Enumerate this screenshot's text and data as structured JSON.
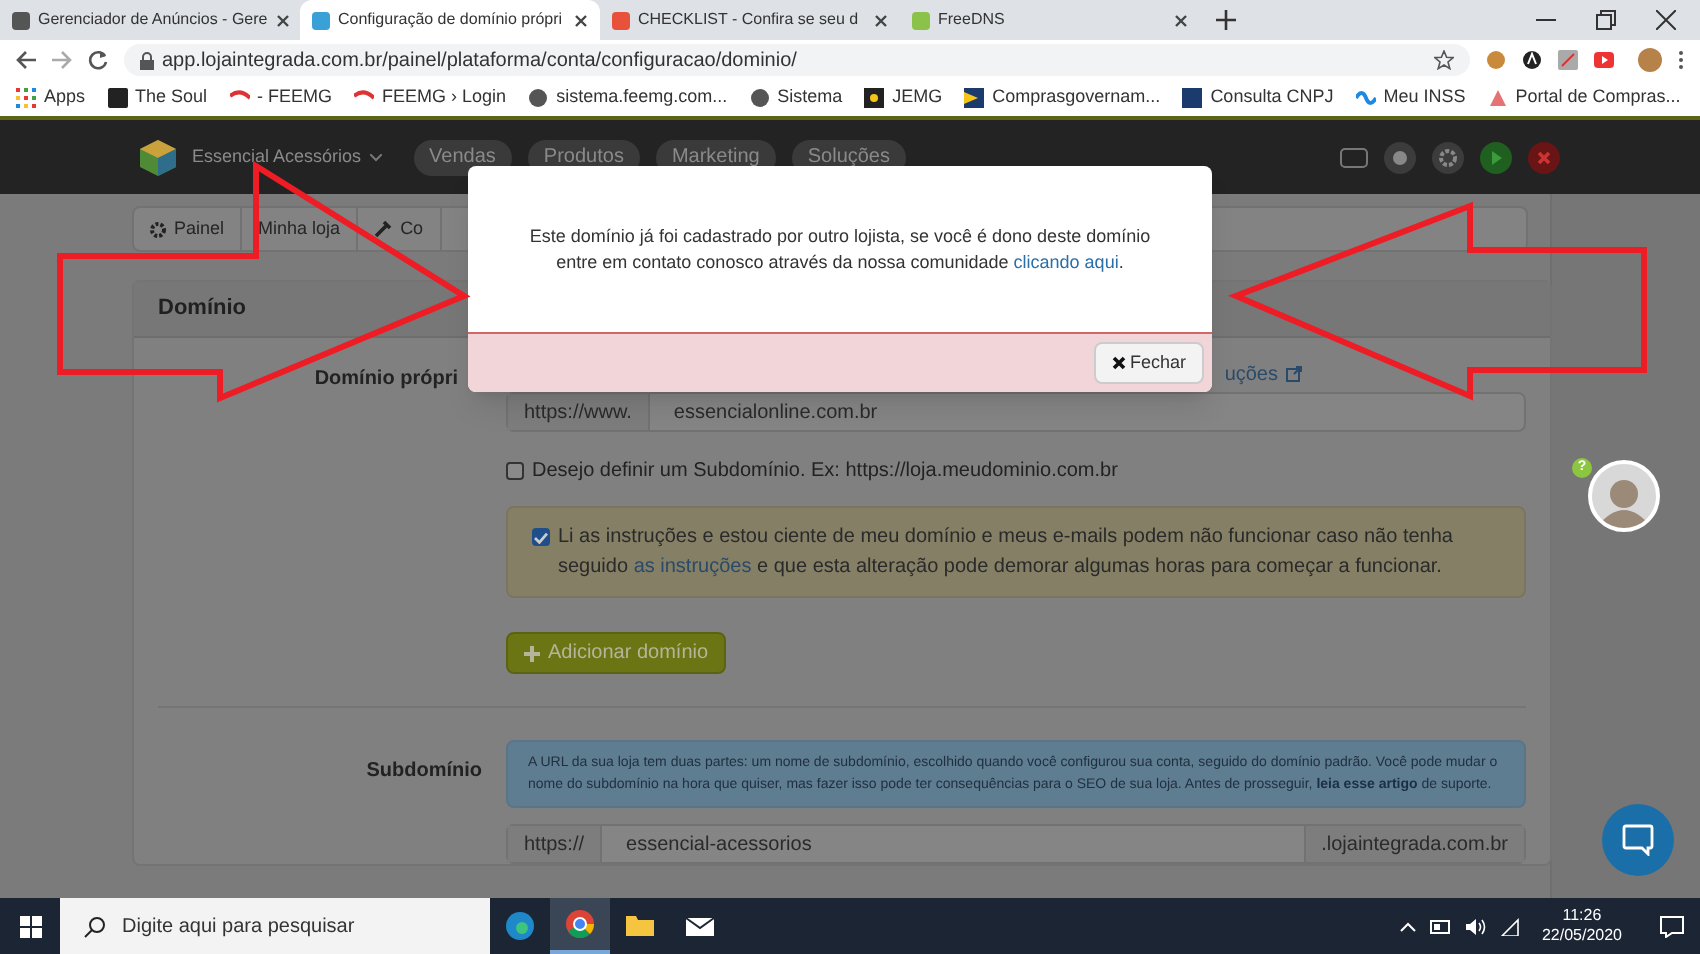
{
  "browser": {
    "tabs": [
      {
        "title": "Gerenciador de Anúncios - Gere",
        "selected": false
      },
      {
        "title": "Configuração de domínio própri",
        "selected": true
      },
      {
        "title": "CHECKLIST - Confira se seu d",
        "selected": false
      },
      {
        "title": "FreeDNS",
        "selected": false
      }
    ],
    "url": "app.lojaintegrada.com.br/painel/plataforma/conta/configuracao/dominio/",
    "bookmarks": [
      "Apps",
      "The Soul",
      "- FEEMG",
      "FEEMG › Login",
      "sistema.feemg.com...",
      "Sistema",
      "JEMG",
      "Comprasgovernam...",
      "Consulta CNPJ",
      "Meu INSS",
      "Portal de Compras..."
    ]
  },
  "app_header": {
    "store": "Essencial Acessórios",
    "nav": [
      "Vendas",
      "Produtos",
      "Marketing",
      "Soluções"
    ]
  },
  "breadcrumb": [
    "Painel",
    "Minha loja",
    "Co"
  ],
  "card": {
    "title": "Domínio",
    "own_domain": {
      "label": "Domínio própri",
      "instructions_link": "uções",
      "prefix": "https://www.",
      "value": "essencialonline.com.br"
    },
    "subdomain_option": {
      "label": "Desejo definir um Subdomínio. Ex: https://loja.meudominio.com.br",
      "checked": false
    },
    "agreement": {
      "text": "Li as instruções e estou ciente de meu domínio e meus e-mails podem não funcionar caso não tenha seguido",
      "link": "as instruções",
      "text_after": "e que esta alteração pode demorar algumas horas para começar a funcionar.",
      "checked": true
    },
    "add_button": "Adicionar domínio",
    "subdomain": {
      "label": "Subdomínio",
      "info": "A URL da sua loja tem duas partes: um nome de subdomínio, escolhido quando você configurou sua conta, seguido do domínio padrão. Você pode mudar o nome do subdomínio na hora que quiser, mas fazer isso pode ter consequências para o SEO de sua loja. Antes de prosseguir,",
      "info_link": "leia esse artigo",
      "info_after": "de suporte.",
      "prefix": "https://",
      "value": "essencial-acessorios",
      "suffix": ".lojaintegrada.com.br"
    }
  },
  "help_badge": "?",
  "modal": {
    "message": "Este domínio já foi cadastrado por outro lojista, se você é dono deste domínio entre em contato conosco através da nossa comunidade",
    "link": "clicando aqui",
    "after": ".",
    "button": "Fechar"
  },
  "taskbar": {
    "search_placeholder": "Digite aqui para pesquisar",
    "time": "11:26",
    "date": "22/05/2020"
  }
}
